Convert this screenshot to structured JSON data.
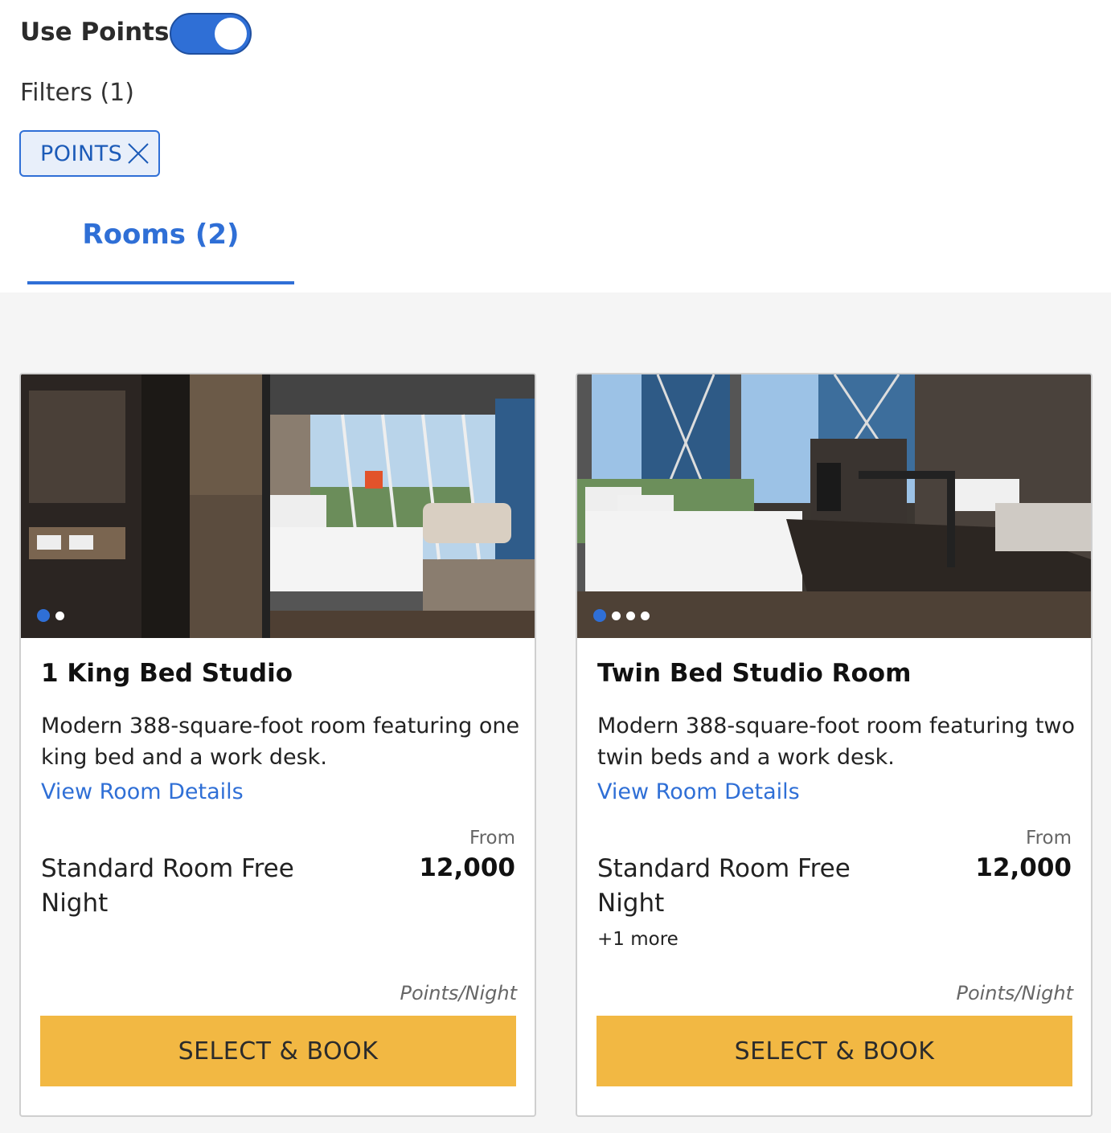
{
  "header": {
    "use_points_label": "Use Points",
    "use_points_on": true,
    "filters_label": "Filters (1)",
    "active_filter": "POINTS",
    "accent_color": "#2f6fd6"
  },
  "tabs": [
    {
      "label": "Rooms (2)",
      "selected": true
    }
  ],
  "rooms": [
    {
      "title": "1 King Bed Studio",
      "description": "Modern 388-square-foot room featuring one king bed and a work desk.",
      "details_link": "View Room Details",
      "rate_name": "Standard Room Free Night",
      "more_rates": "",
      "from_label": "From",
      "price": "12,000",
      "unit": "Points/Night",
      "book_label": "SELECT & BOOK",
      "photo_count": 2,
      "photo_index": 1
    },
    {
      "title": "Twin Bed Studio Room",
      "description": "Modern 388-square-foot room featuring two twin beds and a work desk.",
      "details_link": "View Room Details",
      "rate_name": "Standard Room Free Night",
      "more_rates": "+1 more",
      "from_label": "From",
      "price": "12,000",
      "unit": "Points/Night",
      "book_label": "SELECT & BOOK",
      "photo_count": 4,
      "photo_index": 1
    }
  ],
  "colors": {
    "book_button": "#f2b843",
    "list_background": "#f5f5f5"
  }
}
